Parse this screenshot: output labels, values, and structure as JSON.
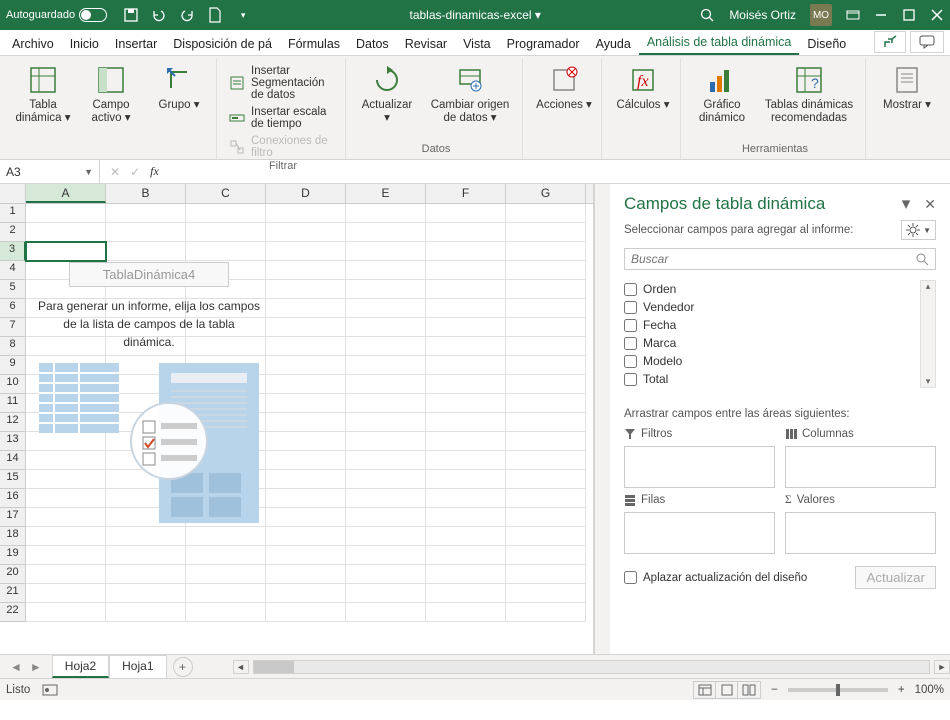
{
  "titlebar": {
    "autosave_label": "Autoguardado",
    "doc_name": "tablas-dinamicas-excel ▾",
    "user_name": "Moisés Ortiz",
    "user_initials": "MO"
  },
  "tabs": {
    "items": [
      "Archivo",
      "Inicio",
      "Insertar",
      "Disposición de pá",
      "Fórmulas",
      "Datos",
      "Revisar",
      "Vista",
      "Programador",
      "Ayuda",
      "Análisis de tabla dinámica",
      "Diseño"
    ],
    "active_index": 10
  },
  "ribbon": {
    "groups": {
      "g0": {
        "btn0": "Tabla\ndinámica ▾",
        "btn1": "Campo\nactivo ▾",
        "btn2": "Grupo\n▾"
      },
      "filtrar": {
        "label": "Filtrar",
        "i0": "Insertar Segmentación de datos",
        "i1": "Insertar escala de tiempo",
        "i2": "Conexiones de filtro"
      },
      "datos": {
        "label": "Datos",
        "btn0": "Actualizar\n▾",
        "btn1": "Cambiar origen\nde datos ▾"
      },
      "acciones": {
        "btn": "Acciones\n▾"
      },
      "calculos": {
        "btn": "Cálculos\n▾"
      },
      "herramientas": {
        "label": "Herramientas",
        "btn0": "Gráfico\ndinámico",
        "btn1": "Tablas dinámicas\nrecomendadas"
      },
      "mostrar": {
        "btn": "Mostrar\n▾"
      }
    }
  },
  "formulabar": {
    "namebox": "A3"
  },
  "sheet": {
    "columns": [
      "A",
      "B",
      "C",
      "D",
      "E",
      "F",
      "G"
    ],
    "selected_col_index": 0,
    "row_count": 22,
    "selected_row": 3,
    "pivot_name": "TablaDinámica4",
    "pivot_text": "Para generar un informe, elija los campos de la lista de campos de la tabla dinámica."
  },
  "pane": {
    "title": "Campos de tabla dinámica",
    "subtitle": "Seleccionar campos para agregar al informe:",
    "search_placeholder": "Buscar",
    "fields": [
      "Orden",
      "Vendedor",
      "Fecha",
      "Marca",
      "Modelo",
      "Total"
    ],
    "areas_label": "Arrastrar campos entre las áreas siguientes:",
    "area_filters": "Filtros",
    "area_columns": "Columnas",
    "area_rows": "Filas",
    "area_values": "Valores",
    "defer_label": "Aplazar actualización del diseño",
    "update_btn": "Actualizar"
  },
  "sheettabs": {
    "tabs": [
      "Hoja2",
      "Hoja1"
    ],
    "active_index": 0
  },
  "statusbar": {
    "ready": "Listo",
    "zoom": "100%"
  }
}
